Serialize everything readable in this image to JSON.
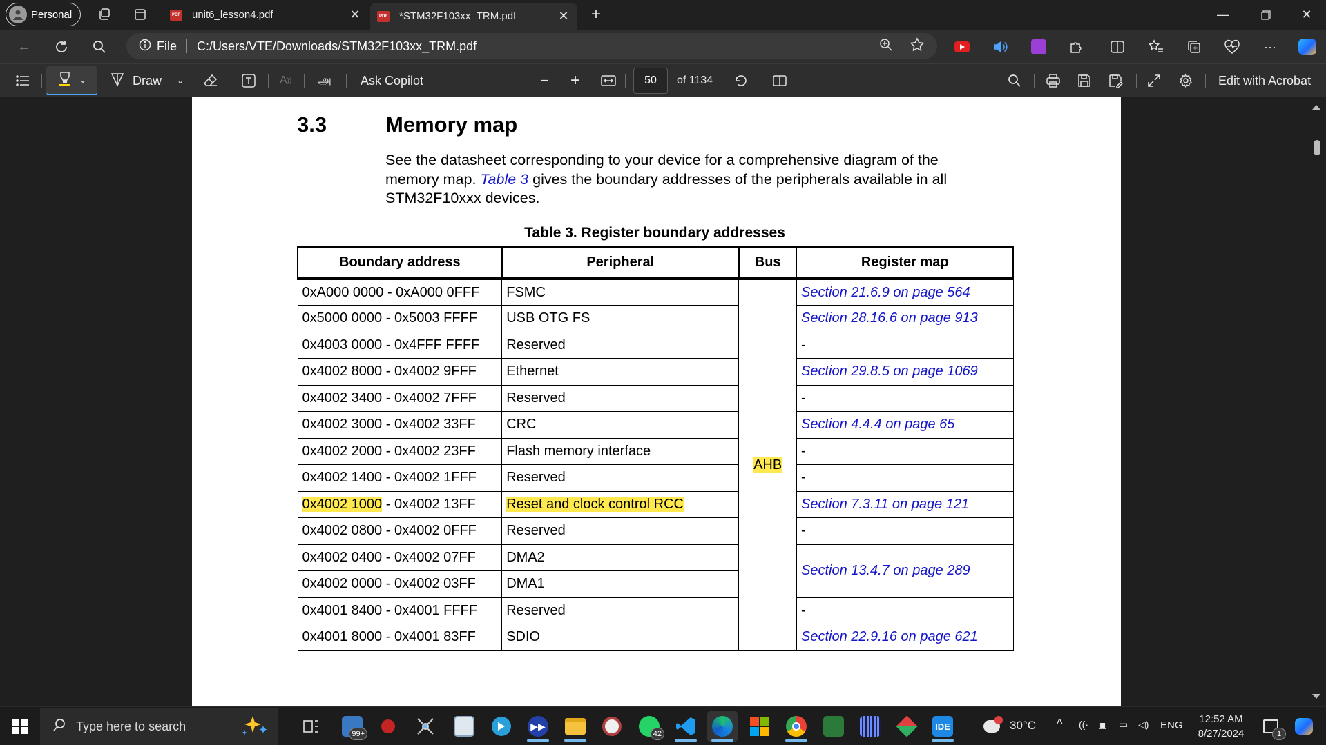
{
  "browser": {
    "profile_label": "Personal",
    "tabs": [
      {
        "title": "unit6_lesson4.pdf",
        "favicon": "PDF",
        "active": false
      },
      {
        "title": "*STM32F103xx_TRM.pdf",
        "favicon": "PDF",
        "active": true
      }
    ],
    "address": {
      "scheme_label": "File",
      "url": "C:/Users/VTE/Downloads/STM32F103xx_TRM.pdf"
    }
  },
  "pdf_toolbar": {
    "draw_label": "Draw",
    "ask_copilot_label": "Ask Copilot",
    "translate_glyph": "அ",
    "text_size_glyph": "A",
    "current_page": "50",
    "page_count_label": "of 1134",
    "edit_acrobat_label": "Edit with Acrobat",
    "highlight_color": "#ffd400"
  },
  "document": {
    "section_number": "3.3",
    "section_title": "Memory map",
    "paragraph": {
      "before_link": "See the datasheet corresponding to your device for a comprehensive diagram of the memory map. ",
      "link": "Table 3",
      "after_link": " gives the boundary addresses of the peripherals available in all STM32F10xxx devices."
    },
    "table_caption": "Table 3. Register boundary addresses",
    "table_headers": [
      "Boundary address",
      "Peripheral",
      "Bus",
      "Register map"
    ],
    "bus_label": "AHB",
    "highlight_color": "#ffe94f",
    "link_color": "#1515c8",
    "rows": [
      {
        "address_a": "0xA000 0000",
        "address_b": " - 0xA000 0FFF",
        "peripheral": "FSMC",
        "register_map": "Section 21.6.9 on page 564"
      },
      {
        "address_a": "0x5000 0000",
        "address_b": " - 0x5003 FFFF",
        "peripheral": "USB OTG FS",
        "register_map": "Section 28.16.6 on page 913"
      },
      {
        "address_a": "0x4003 0000",
        "address_b": " - 0x4FFF FFFF",
        "peripheral": "Reserved",
        "register_map": "-"
      },
      {
        "address_a": "0x4002 8000",
        "address_b": " - 0x4002 9FFF",
        "peripheral": "Ethernet",
        "register_map": "Section 29.8.5 on page 1069"
      },
      {
        "address_a": "0x4002 3400",
        "address_b": " - 0x4002 7FFF",
        "peripheral": "Reserved",
        "register_map": "-"
      },
      {
        "address_a": "0x4002 3000",
        "address_b": " - 0x4002 33FF",
        "peripheral": "CRC",
        "register_map": "Section 4.4.4 on page 65"
      },
      {
        "address_a": "0x4002 2000",
        "address_b": " - 0x4002 23FF",
        "peripheral": "Flash memory interface",
        "register_map": "-"
      },
      {
        "address_a": "0x4002 1400",
        "address_b": " - 0x4002 1FFF",
        "peripheral": "Reserved",
        "register_map": "-"
      },
      {
        "address_a": "0x4002 1000",
        "address_b": " - 0x4002 13FF",
        "peripheral": "Reset and clock control RCC",
        "register_map": "Section 7.3.11 on page 121",
        "highlighted": true
      },
      {
        "address_a": "0x4002 0800",
        "address_b": " - 0x4002 0FFF",
        "peripheral": "Reserved",
        "register_map": "-"
      },
      {
        "address_a": "0x4002 0400",
        "address_b": " - 0x4002 07FF",
        "peripheral": "DMA2",
        "register_map": "Section 13.4.7 on page 289",
        "register_map_rowspan": 2
      },
      {
        "address_a": "0x4002 0000",
        "address_b": " - 0x4002 03FF",
        "peripheral": "DMA1",
        "register_map": null
      },
      {
        "address_a": "0x4001 8400",
        "address_b": " - 0x4001 FFFF",
        "peripheral": "Reserved",
        "register_map": "-"
      },
      {
        "address_a": "0x4001 8000",
        "address_b": " - 0x4001 83FF",
        "peripheral": "SDIO",
        "register_map": "Section 22.9.16 on page 621"
      }
    ]
  },
  "taskbar": {
    "search_placeholder": "Type here to search",
    "mail_badge": "99+",
    "whatsapp_badge": "42",
    "ide_label": "IDE",
    "weather": "30°C",
    "language": "ENG",
    "time": "12:52 AM",
    "date": "8/27/2024",
    "notification_count": "1"
  }
}
